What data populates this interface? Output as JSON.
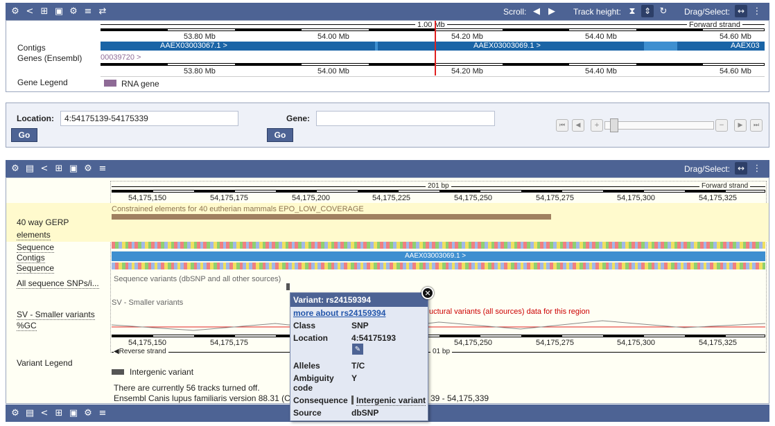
{
  "top_toolbar": {
    "scroll_label": "Scroll:",
    "track_height_label": "Track height:",
    "drag_select_label": "Drag/Select:"
  },
  "overview": {
    "scale_label": "1.00 Mb",
    "strand_label": "Forward strand",
    "ticks": [
      "53.80 Mb",
      "54.00 Mb",
      "54.20 Mb",
      "54.40 Mb",
      "54.60 Mb"
    ],
    "track_labels": [
      "Contigs",
      "Genes (Ensembl)",
      "Gene Legend"
    ],
    "contigs": [
      "AAEX03003067.1 >",
      "AAEX03003069.1 >",
      "AAEX03"
    ],
    "gene_fragment": "00039720 >",
    "legend_item": "RNA gene",
    "colors": {
      "contig": "#1a64a6",
      "contig_light": "#3e8fd0",
      "rna_gene": "#8e6a96",
      "marker": "#e02020"
    }
  },
  "nav": {
    "location_label": "Location:",
    "location_value": "4:54175139-54175339",
    "gene_label": "Gene:",
    "gene_value": "",
    "go_label": "Go"
  },
  "detail_toolbar": {
    "drag_select_label": "Drag/Select:"
  },
  "detail": {
    "scale_label": "201 bp",
    "strand_label": "Forward strand",
    "reverse_strand_label": "Reverse strand",
    "ticks": [
      "54,175,150",
      "54,175,175",
      "54,175,200",
      "54,175,225",
      "54,175,250",
      "54,175,275",
      "54,175,300",
      "54,175,325"
    ],
    "bottom_ticks": [
      "54,175,150",
      "54,175,175",
      "54,175,250",
      "54,175,275",
      "54,175,300",
      "54,175,325"
    ],
    "bottom_scale_fragment": "01 bp",
    "gerp_label_1": "40 way GERP",
    "gerp_label_2": "elements",
    "gerp_desc": "Constrained elements for 40 eutherian mammals EPO_LOW_COVERAGE",
    "sequence_label": "Sequence",
    "contigs_label": "Contigs",
    "sequence_label_2": "Sequence",
    "contig_name": "AAEX03003069.1 >",
    "snps_label": "All sequence SNPs/i...",
    "snps_desc": "Sequence variants (dbSNP and all other sources)",
    "sv_track_desc": "SV - Smaller variants",
    "sv_label": "SV - Smaller variants",
    "gc_label": "%GC",
    "sv_msg_fragment": "uctural variants (all sources) data for this region",
    "variant_legend_label": "Variant Legend",
    "legend_item": "Intergenic variant",
    "footer_1": "There are currently 56 tracks turned off.",
    "footer_2_left": "Ensembl Canis lupus familiaris version 88.31 (C",
    "footer_2_right": "39 - 54,175,339"
  },
  "popup": {
    "title": "Variant: rs24159394",
    "link": "more about rs24159394",
    "rows": [
      {
        "k": "Class",
        "v": "SNP"
      },
      {
        "k": "Location",
        "v": "4:54175193"
      },
      {
        "k": "Alleles",
        "v": "T/C"
      },
      {
        "k": "Ambiguity code",
        "v": "Y"
      },
      {
        "k": "Consequence",
        "v": "Intergenic variant"
      },
      {
        "k": "Source",
        "v": "dbSNP"
      }
    ]
  }
}
